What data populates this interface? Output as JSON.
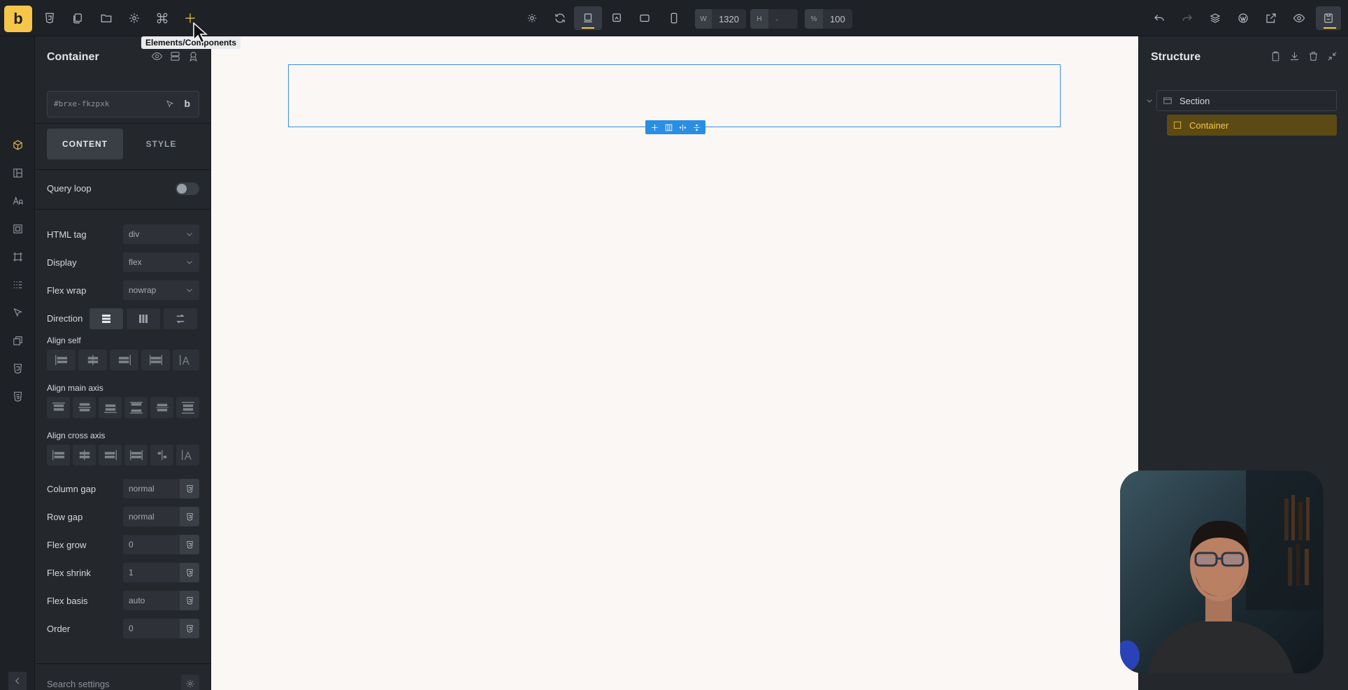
{
  "topbar": {
    "logo_text": "b",
    "tooltip": "Elements/Components",
    "width_label": "W",
    "width_value": "1320",
    "height_label": "H",
    "height_value": "-",
    "zoom_label": "%",
    "zoom_value": "100"
  },
  "panel": {
    "title": "Container",
    "element_id": "#brxe-fkzpxk",
    "tabs": [
      "CONTENT",
      "STYLE"
    ],
    "query_loop_label": "Query loop",
    "query_loop_enabled": false,
    "html_tag": {
      "label": "HTML tag",
      "value": "div"
    },
    "display": {
      "label": "Display",
      "value": "flex"
    },
    "flex_wrap": {
      "label": "Flex wrap",
      "value": "nowrap"
    },
    "direction_label": "Direction",
    "align_self_label": "Align self",
    "align_main_label": "Align main axis",
    "align_cross_label": "Align cross axis",
    "column_gap": {
      "label": "Column gap",
      "value": "normal"
    },
    "row_gap": {
      "label": "Row gap",
      "value": "normal"
    },
    "flex_grow": {
      "label": "Flex grow",
      "value": "0"
    },
    "flex_shrink": {
      "label": "Flex shrink",
      "value": "1"
    },
    "flex_basis": {
      "label": "Flex basis",
      "value": "auto"
    },
    "order": {
      "label": "Order",
      "value": "0"
    },
    "search_placeholder": "Search settings"
  },
  "structure": {
    "title": "Structure",
    "items": [
      {
        "label": "Section"
      },
      {
        "label": "Container"
      }
    ]
  },
  "colors": {
    "accent": "#f5c64a",
    "selection": "#2a8ee2",
    "canvas_bg": "#faf7f5",
    "ui_bg": "#24272c"
  }
}
